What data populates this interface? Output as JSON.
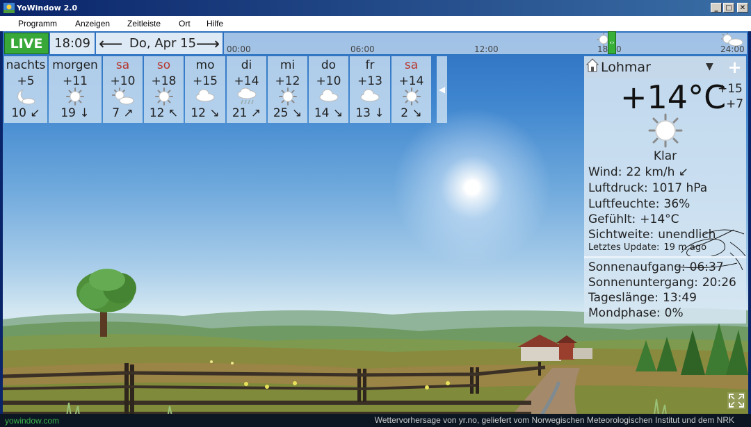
{
  "window": {
    "title": "YoWindow 2.0",
    "minimize_glyph": "_",
    "maximize_glyph": "□",
    "close_glyph": "✕"
  },
  "menu": [
    "Programm",
    "Anzeigen",
    "Zeitleiste",
    "Ort",
    "Hilfe"
  ],
  "topbar": {
    "live_label": "LIVE",
    "time": "18:09",
    "prev_arrow": "⟵",
    "next_arrow": "⟶",
    "date": "Do, Apr 15",
    "timeline_ticks": [
      "00:00",
      "06:00",
      "12:00",
      "18:00",
      "24:00"
    ],
    "timeline_current_time": "18:09",
    "timeline_marker_glyph": "‹›"
  },
  "forecast": [
    {
      "name": "nachts",
      "temp": "+5",
      "icon": "moon-sun-icon",
      "wind": "10 ↙",
      "weekend": false
    },
    {
      "name": "morgen",
      "temp": "+11",
      "icon": "sun-icon",
      "wind": "19 ↓",
      "weekend": false
    },
    {
      "name": "sa",
      "temp": "+10",
      "icon": "sun-cloud-icon",
      "wind": "7 ↗",
      "weekend": true
    },
    {
      "name": "so",
      "temp": "+18",
      "icon": "sun-icon",
      "wind": "12 ↖",
      "weekend": true
    },
    {
      "name": "mo",
      "temp": "+15",
      "icon": "cloud-icon",
      "wind": "12 ↘",
      "weekend": false
    },
    {
      "name": "di",
      "temp": "+14",
      "icon": "rain-cloud-icon",
      "wind": "21 ↗",
      "weekend": false
    },
    {
      "name": "mi",
      "temp": "+12",
      "icon": "sun-icon",
      "wind": "25 ↘",
      "weekend": false
    },
    {
      "name": "do",
      "temp": "+10",
      "icon": "cloud-icon",
      "wind": "14 ↘",
      "weekend": false
    },
    {
      "name": "fr",
      "temp": "+13",
      "icon": "cloud-icon",
      "wind": "13 ↓",
      "weekend": false
    },
    {
      "name": "sa",
      "temp": "+14",
      "icon": "sun-icon",
      "wind": "2 ↘",
      "weekend": true
    }
  ],
  "forecast_collapse_glyph": "◀",
  "panel": {
    "location": "Lohmar",
    "dropdown_glyph": "▼",
    "add_glyph": "+",
    "temperature": "+14°C",
    "high": "+15",
    "low": "+7",
    "condition": "Klar",
    "details": [
      {
        "label": "Wind:",
        "value": "22 km/h  ↙"
      },
      {
        "label": "Luftdruck:",
        "value": "1017 hPa"
      },
      {
        "label": "Luftfeuchte:",
        "value": "36%"
      },
      {
        "label": "Gefühlt:",
        "value": "+14°C"
      },
      {
        "label": "Sichtweite:",
        "value": "unendlich"
      }
    ],
    "update_label": "Letztes Update:",
    "update_value": "19 m ago",
    "sun": [
      {
        "label": "Sonnenaufgang:",
        "value": "06:37"
      },
      {
        "label": "Sonnenuntergang:",
        "value": "20:26"
      },
      {
        "label": "Tageslänge:",
        "value": "13:49"
      },
      {
        "label": "Mondphase:",
        "value": "0%"
      }
    ]
  },
  "footer": {
    "left": "yowindow.com",
    "right": "Wettervorhersage von yr.no, geliefert vom Norwegischen Meteorologischen Institut und dem NRK"
  },
  "colors": {
    "live_green": "#38a838",
    "weekend_red": "#b8342a",
    "footer_link_green": "#3fb24a",
    "titlebar_blue": "#0a246a"
  }
}
